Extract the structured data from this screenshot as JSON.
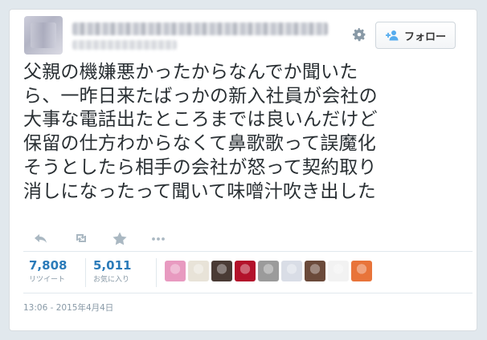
{
  "header": {
    "follow_label": "フォロー"
  },
  "tweet": {
    "text": "父親の機嫌悪かったからなんでか聞いた\nら、一昨日来たばっかの新入社員が会社の\n大事な電話出たところまでは良いんだけど\n保留の仕方わからなくて鼻歌歌って誤魔化\nそうとしたら相手の会社が怒って契約取り\n消しになったって聞いて味噌汁吹き出した",
    "timestamp": "13:06 - 2015年4月4日"
  },
  "actions": [
    {
      "icon": "reply-icon"
    },
    {
      "icon": "retweet-icon"
    },
    {
      "icon": "favorite-star-icon"
    },
    {
      "icon": "more-icon"
    }
  ],
  "stats": {
    "retweets": {
      "count": "7,808",
      "label": "リツイート"
    },
    "favorites": {
      "count": "5,011",
      "label": "お気に入り"
    }
  },
  "favoriters": [
    {
      "name": "favoriter-avatar-1",
      "color": "#e89ac0"
    },
    {
      "name": "favoriter-avatar-2",
      "color": "#e8e3d8"
    },
    {
      "name": "favoriter-avatar-3",
      "color": "#4a3b35"
    },
    {
      "name": "favoriter-avatar-4",
      "color": "#b3122b"
    },
    {
      "name": "favoriter-avatar-5",
      "color": "#9b9b9b"
    },
    {
      "name": "favoriter-avatar-6",
      "color": "#d9dde6"
    },
    {
      "name": "favoriter-avatar-7",
      "color": "#6b4a3a"
    },
    {
      "name": "favoriter-avatar-8",
      "color": "#f2f2f2"
    },
    {
      "name": "favoriter-avatar-9",
      "color": "#e8743a"
    }
  ],
  "colors": {
    "link_blue": "#2b7bb9",
    "text": "#292f33",
    "muted": "#8899a6",
    "border": "#e1e8ed"
  }
}
